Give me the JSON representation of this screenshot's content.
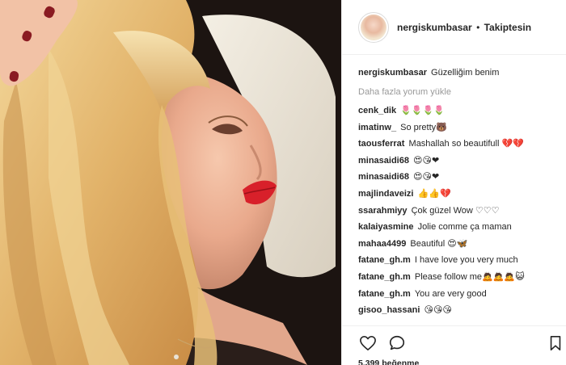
{
  "post": {
    "username": "nergiskumbasar",
    "separator": "•",
    "follow_status": "Takiptesin",
    "caption": "Güzelliğim benim",
    "load_more": "Daha fazla yorum yükle",
    "likes": "5.399 beğenme"
  },
  "comments": [
    {
      "user": "cenk_dik",
      "text": "🌷🌷🌷🌷"
    },
    {
      "user": "imatinw_",
      "text": "So pretty🐻"
    },
    {
      "user": "taousferrat",
      "text": "Mashallah so beautifull 💔💔"
    },
    {
      "user": "minasaidi68",
      "text": "😍😘❤"
    },
    {
      "user": "minasaidi68",
      "text": "😍😘❤"
    },
    {
      "user": "majlindaveizi",
      "text": "👍👍💔"
    },
    {
      "user": "ssarahmiyy",
      "text": "Çok güzel Wow ♡♡♡"
    },
    {
      "user": "kalaiyasmine",
      "text": "Jolie comme ça maman"
    },
    {
      "user": "mahaa4499",
      "text": "Beautiful 😍🦋"
    },
    {
      "user": "fatane_gh.m",
      "text": "I have love you very much"
    },
    {
      "user": "fatane_gh.m",
      "text": "Please follow me🙇🙇🙇😺"
    },
    {
      "user": "fatane_gh.m",
      "text": "You are very good"
    },
    {
      "user": "gisoo_hassani",
      "text": "😘😘😘"
    }
  ],
  "icons": {
    "like": "heart-outline-icon",
    "comment": "speech-bubble-icon",
    "save": "bookmark-icon"
  },
  "colors": {
    "text": "#262626",
    "muted": "#999999",
    "divider": "#efefef",
    "lipstick": "#d8202a"
  }
}
